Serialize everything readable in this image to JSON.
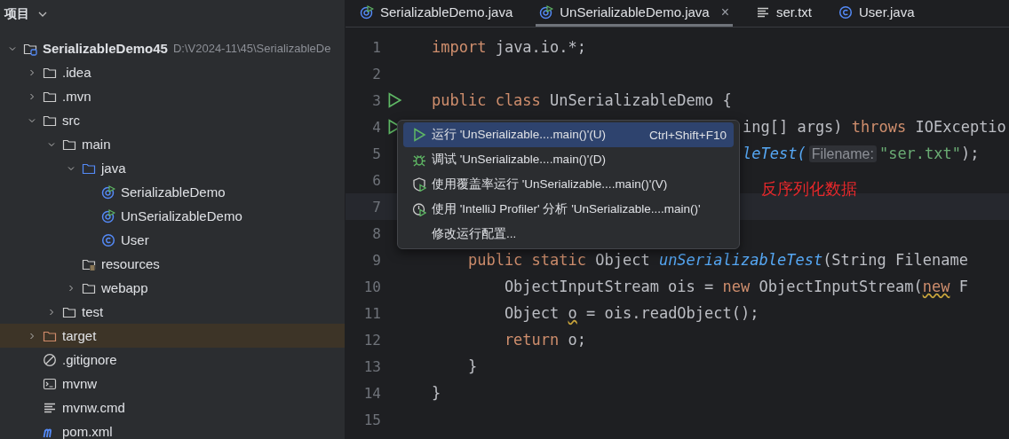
{
  "sidebar": {
    "title": "项目",
    "tree": [
      {
        "kind": "project",
        "label": "SerializableDemo45",
        "path": "D:\\V2024-11\\45\\SerializableDe",
        "expanded": true,
        "children": [
          {
            "kind": "folder",
            "label": ".idea",
            "expanded": false
          },
          {
            "kind": "folder",
            "label": ".mvn",
            "expanded": false
          },
          {
            "kind": "folder",
            "label": "src",
            "expanded": true,
            "children": [
              {
                "kind": "folder",
                "label": "main",
                "expanded": true,
                "children": [
                  {
                    "kind": "source",
                    "label": "java",
                    "expanded": true,
                    "children": [
                      {
                        "kind": "runnable-class",
                        "label": "SerializableDemo"
                      },
                      {
                        "kind": "runnable-class",
                        "label": "UnSerializableDemo"
                      },
                      {
                        "kind": "class",
                        "label": "User"
                      }
                    ]
                  },
                  {
                    "kind": "resources",
                    "label": "resources"
                  },
                  {
                    "kind": "folder",
                    "label": "webapp",
                    "expanded": false
                  }
                ]
              },
              {
                "kind": "folder",
                "label": "test",
                "expanded": false
              }
            ]
          },
          {
            "kind": "excluded",
            "label": "target",
            "expanded": false
          },
          {
            "kind": "ignore",
            "label": ".gitignore"
          },
          {
            "kind": "script",
            "label": "mvnw"
          },
          {
            "kind": "text",
            "label": "mvnw.cmd"
          },
          {
            "kind": "maven",
            "label": "pom.xml"
          }
        ]
      }
    ]
  },
  "tabs": [
    {
      "kind": "runnable-class",
      "label": "SerializableDemo.java",
      "selected": false
    },
    {
      "kind": "runnable-class",
      "label": "UnSerializableDemo.java",
      "selected": true,
      "close": "×"
    },
    {
      "kind": "text",
      "label": "ser.txt",
      "selected": false
    },
    {
      "kind": "class",
      "label": "User.java",
      "selected": false
    }
  ],
  "editor": {
    "lines": [
      {
        "number": "1",
        "tokens": [
          {
            "kind": "keyword",
            "text": "import"
          },
          {
            "kind": "plain",
            "text": " java.io.*;"
          }
        ]
      },
      {
        "number": "2"
      },
      {
        "number": "3",
        "run": true,
        "tokens": [
          {
            "kind": "keyword",
            "text": "public class"
          },
          {
            "kind": "plain",
            "text": " UnSerializableDemo {"
          }
        ]
      },
      {
        "number": "4",
        "run": true,
        "covered": true,
        "tokens": [
          {
            "kind": "plain",
            "text": "ing[] args) "
          },
          {
            "kind": "keyword",
            "text": "throws"
          },
          {
            "kind": "plain",
            "text": " IOExceptio"
          }
        ]
      },
      {
        "number": "5",
        "covered": true,
        "tokens": [
          {
            "kind": "call",
            "text": "leTest("
          },
          {
            "kind": "hint",
            "text": "Filename:"
          },
          {
            "kind": "string",
            "text": "\"ser.txt\""
          },
          {
            "kind": "plain",
            "text": ");"
          }
        ]
      },
      {
        "number": "6"
      },
      {
        "number": "7",
        "current": true
      },
      {
        "number": "8"
      },
      {
        "number": "9",
        "tokens": [
          {
            "kind": "indent"
          },
          {
            "kind": "keyword",
            "text": "public static"
          },
          {
            "kind": "plain",
            "text": " Object "
          },
          {
            "kind": "method",
            "text": "unSerializableTest"
          },
          {
            "kind": "plain",
            "text": "(String Filename"
          }
        ]
      },
      {
        "number": "10",
        "tokens": [
          {
            "kind": "indent"
          },
          {
            "kind": "indent"
          },
          {
            "kind": "plain",
            "text": "ObjectInputStream ois = "
          },
          {
            "kind": "keyword",
            "text": "new"
          },
          {
            "kind": "plain",
            "text": " ObjectInputStream("
          },
          {
            "kind": "warn-keyword",
            "text": "new"
          },
          {
            "kind": "plain",
            "text": " F"
          }
        ]
      },
      {
        "number": "11",
        "tokens": [
          {
            "kind": "indent"
          },
          {
            "kind": "indent"
          },
          {
            "kind": "plain",
            "text": "Object "
          },
          {
            "kind": "warn",
            "text": "o"
          },
          {
            "kind": "plain",
            "text": " = ois.readObject();"
          }
        ]
      },
      {
        "number": "12",
        "tokens": [
          {
            "kind": "indent"
          },
          {
            "kind": "indent"
          },
          {
            "kind": "keyword",
            "text": "return"
          },
          {
            "kind": "plain",
            "text": " o;"
          }
        ]
      },
      {
        "number": "13",
        "tokens": [
          {
            "kind": "indent"
          },
          {
            "kind": "plain",
            "text": "}"
          }
        ]
      },
      {
        "number": "14",
        "tokens": [
          {
            "kind": "plain",
            "text": "}"
          }
        ]
      },
      {
        "number": "15"
      }
    ],
    "annotation": "反序列化数据"
  },
  "run_menu": {
    "items": [
      {
        "kind": "run",
        "label": "运行 'UnSerializable....main()'(U)",
        "shortcut": "Ctrl+Shift+F10",
        "selected": true
      },
      {
        "kind": "debug",
        "label": "调试 'UnSerializable....main()'(D)",
        "selected": false
      },
      {
        "kind": "coverage",
        "label": "使用覆盖率运行 'UnSerializable....main()'(V)",
        "selected": false
      },
      {
        "kind": "profiler",
        "label": "使用 'IntelliJ Profiler' 分析  'UnSerializable....main()'",
        "selected": false
      },
      {
        "kind": "plain",
        "label": "修改运行配置...",
        "selected": false
      }
    ]
  }
}
